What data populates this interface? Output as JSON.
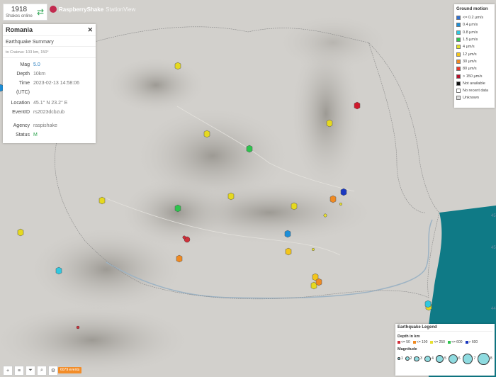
{
  "topbar": {
    "shakes_count": "1918",
    "shakes_label": "Shakes online",
    "brand": "RaspberryShake",
    "brand_suffix": "StationView"
  },
  "panel": {
    "title": "Romania",
    "summary_title": "Earthquake Summary",
    "subtitle": "to Craiova: 103 km, 150°",
    "fields": [
      {
        "key": "Mag",
        "value": "5.0"
      },
      {
        "key": "Depth",
        "value": "10km"
      },
      {
        "key": "Time",
        "value": "2023-02-13 14:58:06"
      },
      {
        "key": "(UTC)",
        "value": ""
      },
      {
        "key": "Location",
        "value": "45.1° N 23.2° E"
      },
      {
        "key": "EventID",
        "value": "rs2023dcbzub"
      },
      {
        "key": "Agency",
        "value": "raspishake"
      },
      {
        "key": "Status",
        "value": "M"
      }
    ]
  },
  "ground_motion_legend": {
    "title": "Ground motion",
    "items": [
      {
        "label": "<= 0.2 µm/s",
        "color": "#2f6fd0"
      },
      {
        "label": "0.4 µm/s",
        "color": "#1d8fd8"
      },
      {
        "label": "0.8 µm/s",
        "color": "#30c8e0"
      },
      {
        "label": "1.5 µm/s",
        "color": "#2ec44d"
      },
      {
        "label": "4 µm/s",
        "color": "#e6e229"
      },
      {
        "label": "12 µm/s",
        "color": "#f3c51b"
      },
      {
        "label": "30 µm/s",
        "color": "#f08a22"
      },
      {
        "label": "80 µm/s",
        "color": "#e8362b"
      },
      {
        "label": "> 150 µm/s",
        "color": "#b5122b"
      },
      {
        "label": "Not available",
        "color": "#111111"
      },
      {
        "label": "No recent data",
        "color": "#ffffff"
      },
      {
        "label": "Unknown",
        "color": "#dddddd"
      }
    ]
  },
  "earthquake_legend": {
    "title": "Earthquake Legend",
    "depth_title": "Depth in km",
    "depths": [
      {
        "label": "<= 50",
        "color": "#d0303a"
      },
      {
        "label": "<= 100",
        "color": "#f08a22"
      },
      {
        "label": "<= 250",
        "color": "#e8e030"
      },
      {
        "label": "<= 600",
        "color": "#2ec44d"
      },
      {
        "label": "> 600",
        "color": "#1a38c0"
      }
    ],
    "magnitude_title": "Magnitude",
    "magnitudes": [
      "1",
      "2",
      "3",
      "4",
      "5",
      "6",
      "7",
      "8"
    ]
  },
  "bottom_toolbar": {
    "events_button": "6079 events"
  },
  "map_labels": {
    "right_lat_1": "45°N",
    "right_lat_2": "44°N",
    "right_lat_3": "44°"
  }
}
